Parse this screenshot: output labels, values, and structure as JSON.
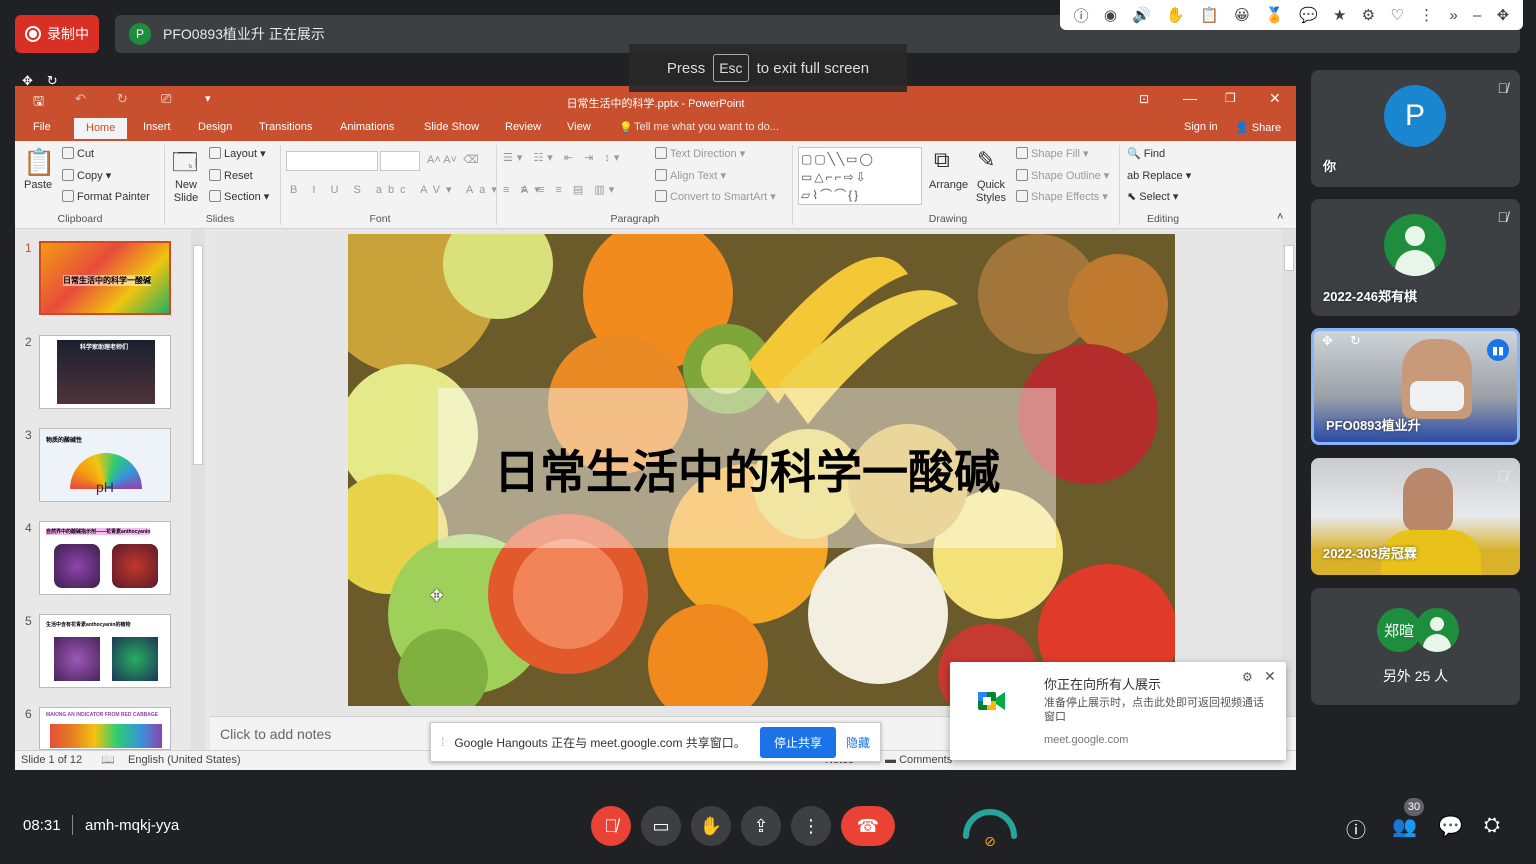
{
  "topbar": {
    "recording_label": "录制中",
    "presenter_initial": "P",
    "presenting_text": "PFO0893植业升 正在展示"
  },
  "extensions": [
    "ⓘ",
    "◉",
    "🔊",
    "✋",
    "📋",
    "😀",
    "🏅",
    "💬",
    "★",
    "⚙",
    "♡",
    "⋮",
    "»",
    "–",
    "✥"
  ],
  "fullscreen_toast": {
    "press": "Press",
    "key": "Esc",
    "rest": "to exit full screen"
  },
  "powerpoint": {
    "window_title": "日常生活中的科学.pptx - PowerPoint",
    "tabs": [
      "File",
      "Home",
      "Insert",
      "Design",
      "Transitions",
      "Animations",
      "Slide Show",
      "Review",
      "View"
    ],
    "tell_me": "Tell me what you want to do...",
    "sign_in": "Sign in",
    "share": "Share",
    "ribbon": {
      "clipboard": {
        "paste": "Paste",
        "cut": "Cut",
        "copy": "Copy",
        "format_painter": "Format Painter",
        "label": "Clipboard"
      },
      "slides": {
        "new_slide": "New Slide",
        "layout": "Layout",
        "reset": "Reset",
        "section": "Section",
        "label": "Slides"
      },
      "font": {
        "label": "Font"
      },
      "paragraph": {
        "text_direction": "Text Direction",
        "align_text": "Align Text",
        "convert_smartart": "Convert to SmartArt",
        "label": "Paragraph"
      },
      "drawing": {
        "arrange": "Arrange",
        "quick_styles": "Quick Styles",
        "shape_fill": "Shape Fill",
        "shape_outline": "Shape Outline",
        "shape_effects": "Shape Effects",
        "label": "Drawing"
      },
      "editing": {
        "find": "Find",
        "replace": "Replace",
        "select": "Select",
        "label": "Editing"
      }
    },
    "thumbnails": [
      {
        "num": "1",
        "caption": "日常生活中的科学一酸碱"
      },
      {
        "num": "2",
        "caption": "科学家助理老师们"
      },
      {
        "num": "3",
        "caption": "物质的酸碱性",
        "sub": "pH"
      },
      {
        "num": "4",
        "caption": "自然界中的酸碱指示剂——花青素anthocyanin"
      },
      {
        "num": "5",
        "caption": "生活中含有花青素anthocyanin的植物"
      },
      {
        "num": "6",
        "caption": "MAKING AN INDICATOR FROM RED CABBAGE"
      }
    ],
    "slide_title": "日常生活中的科学一酸碱",
    "notes_placeholder": "Click to add notes",
    "status": {
      "slide_of": "Slide 1 of 12",
      "language": "English (United States)",
      "notes": "Notes",
      "comments": "Comments"
    }
  },
  "share_bar": {
    "text": "Google Hangouts 正在与 meet.google.com 共享窗口。",
    "stop": "停止共享",
    "hide": "隐藏"
  },
  "notification": {
    "title": "你正在向所有人展示",
    "body": "准备停止展示时，点击此处即可返回视频通话窗口",
    "source": "meet.google.com"
  },
  "participants": [
    {
      "name": "你",
      "initial": "P",
      "muted": true
    },
    {
      "name": "2022-246郑有棋",
      "muted": true
    },
    {
      "name": "PFO0893植业升",
      "speaking": true
    },
    {
      "name": "2022-303房冠霖",
      "muted": true
    }
  ],
  "others": {
    "initial": "郑暄",
    "label": "另外 25 人"
  },
  "bottom": {
    "time": "08:31",
    "meeting_code": "amh-mqkj-yya",
    "people_count": "30"
  }
}
